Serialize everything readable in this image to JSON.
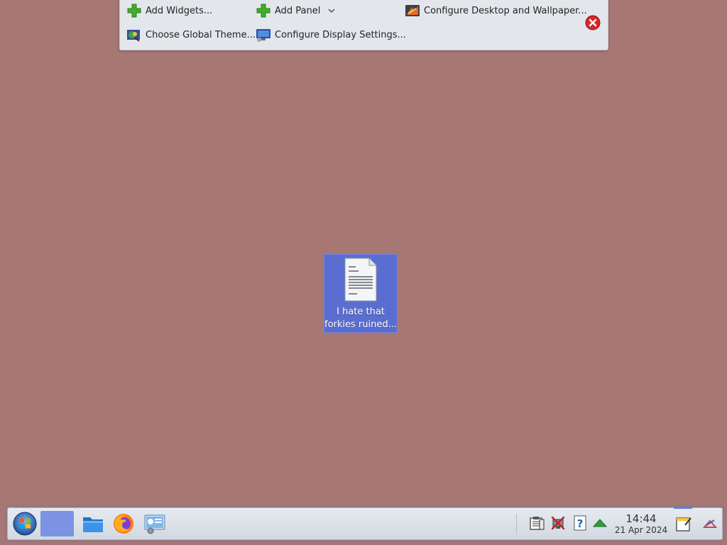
{
  "toolbar": {
    "add_widgets": "Add Widgets...",
    "add_panel": "Add Panel",
    "configure_desktop": "Configure Desktop and Wallpaper...",
    "choose_theme": "Choose Global Theme...",
    "configure_display": "Configure Display Settings..."
  },
  "desktop": {
    "file_label_line1": "I hate that",
    "file_label_line2": "forkies ruined..."
  },
  "panel": {
    "clock_time": "14:44",
    "clock_date": "21 Apr 2024"
  },
  "colors": {
    "wallpaper": "#a67773",
    "selection": "#5a6ed1",
    "accent": "#5b7fde"
  },
  "icons": [
    "plus-icon",
    "chevron-down-icon",
    "desktop-wallpaper-icon",
    "close-icon",
    "theme-icon",
    "display-icon",
    "text-file-icon",
    "start-menu-icon",
    "folder-icon",
    "firefox-icon",
    "system-settings-icon",
    "clipboard-icon",
    "network-disconnected-icon",
    "help-icon",
    "updates-icon",
    "notes-icon",
    "panel-config-icon"
  ]
}
